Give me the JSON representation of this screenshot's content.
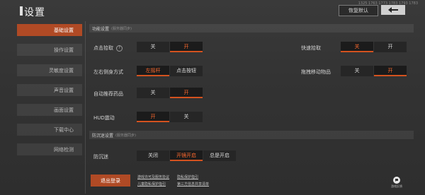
{
  "header": {
    "title": "设置",
    "id_text": "1325 1763 1773 1783 1793 1783",
    "restore_label": "恢复默认",
    "back_icon": "back-arrow-icon"
  },
  "sidebar": {
    "items": [
      {
        "label": "基础设置",
        "active": true
      },
      {
        "label": "操作设置",
        "active": false
      },
      {
        "label": "灵敏度设置",
        "active": false
      },
      {
        "label": "声音设置",
        "active": false
      },
      {
        "label": "画面设置",
        "active": false
      },
      {
        "label": "下载中心",
        "active": false
      },
      {
        "label": "网络检测",
        "active": false
      }
    ]
  },
  "section_function": {
    "title": "功能设置",
    "subtitle": "服务器同步"
  },
  "rows": {
    "click_pickup": {
      "label": "点击拾取",
      "help": "?",
      "opt1": "关",
      "opt2": "开",
      "selected": "开"
    },
    "rapid_pickup": {
      "label": "快速拾取",
      "opt1": "关",
      "opt2": "开",
      "selected": "关"
    },
    "lean_mode": {
      "label": "左右侧身方式",
      "opt1": "左摇杆",
      "opt2": "点击按钮",
      "selected": "左摇杆"
    },
    "drag_item": {
      "label": "拖拽移动物品",
      "opt1": "关",
      "opt2": "开",
      "selected": "开"
    },
    "auto_recommend": {
      "label": "自动推荐药品",
      "opt1": "关",
      "opt2": "开",
      "selected": "开"
    },
    "hud_shake": {
      "label": "HUD震动",
      "opt1": "开",
      "opt2": "关",
      "selected": "开"
    }
  },
  "section_anti": {
    "title": "防沉迷设置",
    "subtitle": "服务器同步"
  },
  "anti_addiction": {
    "label": "防沉迷",
    "opt1": "关闭",
    "opt2": "开镜开启",
    "opt3": "总是开启",
    "selected": "开镜开启"
  },
  "footer": {
    "logout_label": "退出登录",
    "links": [
      "游戏许可及服务协议",
      "隐私保护指引",
      "儿童隐私保护指引",
      "第三方信息共享清单"
    ],
    "feedback_label": "游戏反馈"
  },
  "colors": {
    "accent": "#b04a25",
    "selected_text": "#ff6a2e"
  }
}
